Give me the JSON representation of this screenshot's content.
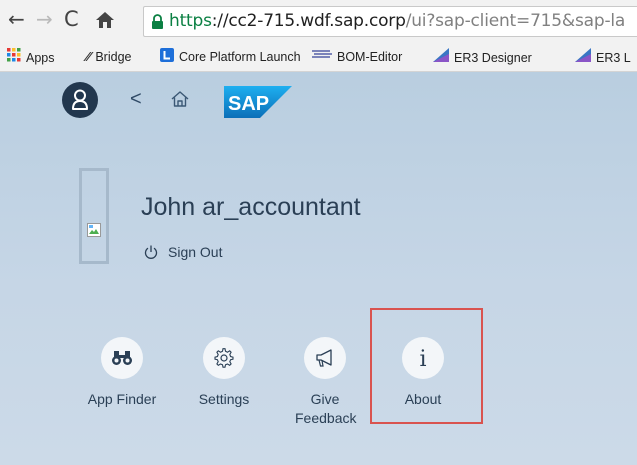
{
  "browser": {
    "url_scheme": "https",
    "url_host": "://cc2-715.wdf.sap.corp",
    "url_path": "/ui?sap-client=715&sap-la"
  },
  "bookmarks": [
    {
      "label": "Apps",
      "icon": "apps-grid-icon"
    },
    {
      "label": "Bridge",
      "icon": "bridge-icon"
    },
    {
      "label": "Core Platform Launch",
      "icon": "l-logo-icon"
    },
    {
      "label": "BOM-Editor",
      "icon": "bom-editor-icon"
    },
    {
      "label": "ER3 Designer",
      "icon": "er3-icon"
    },
    {
      "label": "ER3 L",
      "icon": "er3-icon"
    }
  ],
  "user": {
    "name": "John ar_accountant",
    "sign_out": "Sign Out"
  },
  "actions": [
    {
      "label": "App Finder",
      "icon": "binoculars-icon"
    },
    {
      "label": "Settings",
      "icon": "gear-icon"
    },
    {
      "label": "Give Feedback",
      "icon": "megaphone-icon"
    },
    {
      "label": "About",
      "icon": "info-icon"
    }
  ],
  "colors": {
    "highlight_box": "#d9534f",
    "avatar_bg": "#22374e",
    "sap_blue": "#1b8fd6"
  }
}
